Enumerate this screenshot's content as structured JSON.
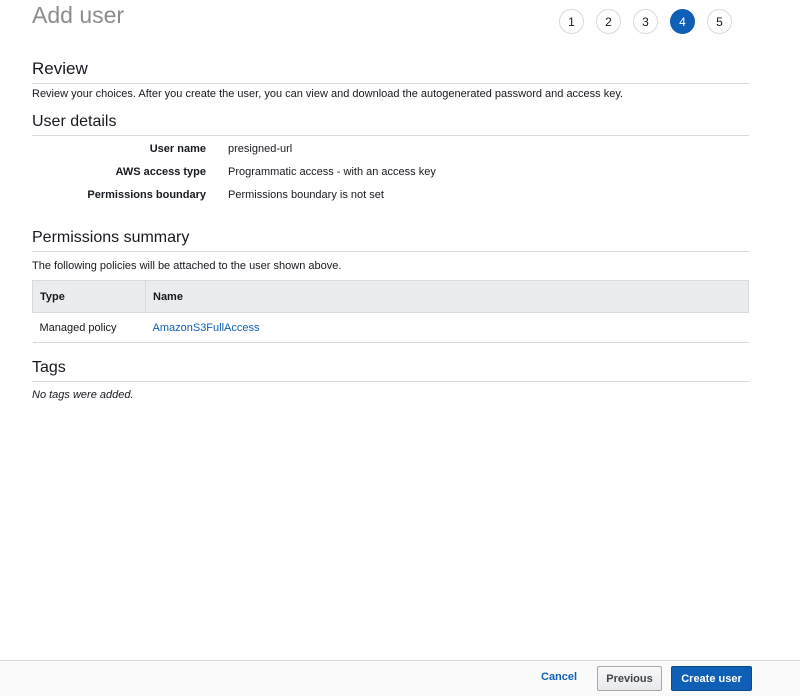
{
  "header": {
    "title": "Add user"
  },
  "steps": [
    {
      "label": "1",
      "active": false
    },
    {
      "label": "2",
      "active": false
    },
    {
      "label": "3",
      "active": false
    },
    {
      "label": "4",
      "active": true
    },
    {
      "label": "5",
      "active": false
    }
  ],
  "review": {
    "heading": "Review",
    "description": "Review your choices. After you create the user, you can view and download the autogenerated password and access key."
  },
  "user_details": {
    "heading": "User details",
    "rows": [
      {
        "label": "User name",
        "value": "presigned-url"
      },
      {
        "label": "AWS access type",
        "value": "Programmatic access - with an access key"
      },
      {
        "label": "Permissions boundary",
        "value": "Permissions boundary is not set"
      }
    ]
  },
  "permissions": {
    "heading": "Permissions summary",
    "description": "The following policies will be attached to the user shown above.",
    "columns": [
      "Type",
      "Name"
    ],
    "rows": [
      {
        "type": "Managed policy",
        "name": "AmazonS3FullAccess"
      }
    ]
  },
  "tags": {
    "heading": "Tags",
    "empty_text": "No tags were added."
  },
  "footer": {
    "cancel_label": "Cancel",
    "previous_label": "Previous",
    "create_label": "Create user"
  },
  "colors": {
    "accent": "#0f5fb6",
    "border": "#d5dbdb",
    "title_gray": "#8c8c8c"
  }
}
